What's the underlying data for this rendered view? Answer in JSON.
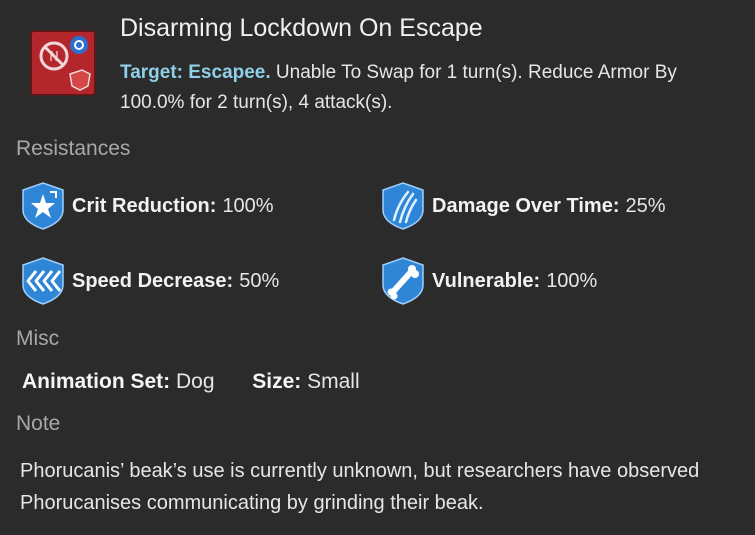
{
  "ability": {
    "icon": "lockdown-disarm-icon",
    "title": "Disarming Lockdown On Escape",
    "target_label": "Target: Escapee.",
    "description": " Unable To Swap for 1 turn(s). Reduce Armor By 100.0% for 2 turn(s), 4 attack(s)."
  },
  "sections": {
    "resistances": "Resistances",
    "misc": "Misc",
    "note": "Note"
  },
  "resistances": [
    {
      "icon": "crit-reduction-icon",
      "label": "Crit Reduction:",
      "value": "100%"
    },
    {
      "icon": "damage-over-time-icon",
      "label": "Damage Over Time:",
      "value": "25%"
    },
    {
      "icon": "speed-decrease-icon",
      "label": "Speed Decrease:",
      "value": "50%"
    },
    {
      "icon": "vulnerable-icon",
      "label": "Vulnerable:",
      "value": "100%"
    }
  ],
  "misc": {
    "animation_label": "Animation Set:",
    "animation_value": "Dog",
    "size_label": "Size:",
    "size_value": "Small"
  },
  "note_text": "Phorucanis’ beak’s use is currently unknown, but researchers have observed Phorucanises communicating by grinding their beak.",
  "colors": {
    "background": "#2b2b2b",
    "accent_target": "#8fd0e8",
    "ability_icon_red": "#b3262b",
    "shield_blue": "#2f86d6"
  }
}
